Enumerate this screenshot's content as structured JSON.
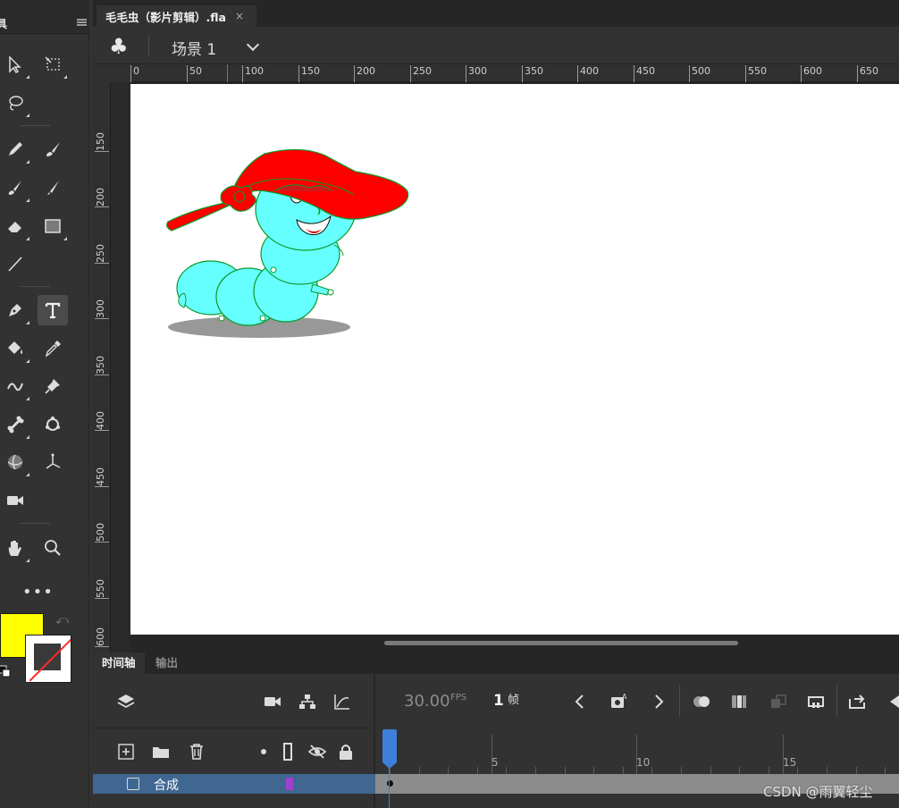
{
  "tools_panel": {
    "title": "具",
    "more_label": "•••",
    "colors": {
      "fill": "#ffff00",
      "stroke": "#3a3a3a"
    }
  },
  "document": {
    "tab_label": "毛毛虫（影片剪辑）.fla",
    "close_glyph": "×"
  },
  "scene": {
    "icon_glyph": "♣",
    "label": "场景 1"
  },
  "rulers": {
    "horizontal": [
      "0",
      "50",
      "100",
      "150",
      "200",
      "250",
      "300",
      "350",
      "400",
      "450",
      "500",
      "550",
      "600",
      "650"
    ],
    "vertical": [
      "150",
      "200",
      "250",
      "300",
      "350",
      "400",
      "450",
      "500",
      "550",
      "600"
    ]
  },
  "panels": {
    "timeline_tab": "时间轴",
    "output_tab": "输出"
  },
  "timeline": {
    "fps_value": "30.00",
    "fps_unit": "FPS",
    "frame_value": "1",
    "frame_unit": "帧",
    "frame_numbers": [
      "5",
      "10",
      "15"
    ],
    "layer": {
      "name": "合成",
      "color": "#a040d0"
    }
  },
  "watermark": "CSDN @雨翼轻尘"
}
